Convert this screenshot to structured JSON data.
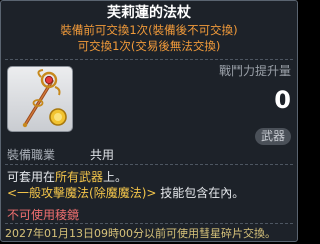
{
  "item": {
    "name": "芙莉蓮的法杖",
    "trade_line_1": "裝備前可交換1次(裝備後不可交換)",
    "trade_line_2": "可交換1次(交易後無法交換)",
    "icon": "staff-icon",
    "power_label": "戰鬥力提升量",
    "power_value": "0",
    "category": "武器",
    "job_label": "裝備職業",
    "job_value": "共用",
    "desc_line_1_prefix": "可套用在",
    "desc_line_1_highlight": "所有武器",
    "desc_line_1_suffix": "上。",
    "desc_line_2_highlight": "<一般攻擊魔法(除魔魔法)>",
    "desc_line_2_suffix": " 技能包含在內。",
    "not_usable": "不可使用稜鏡",
    "footer_date": "2027年01月13日09時00分",
    "footer_text": "以前可使用彗星碎片交換。"
  },
  "colors": {
    "trade": "#f29b3a",
    "warning": "#ef6f6f",
    "footer": "#d6c27a",
    "highlight": "#f3c54a"
  }
}
